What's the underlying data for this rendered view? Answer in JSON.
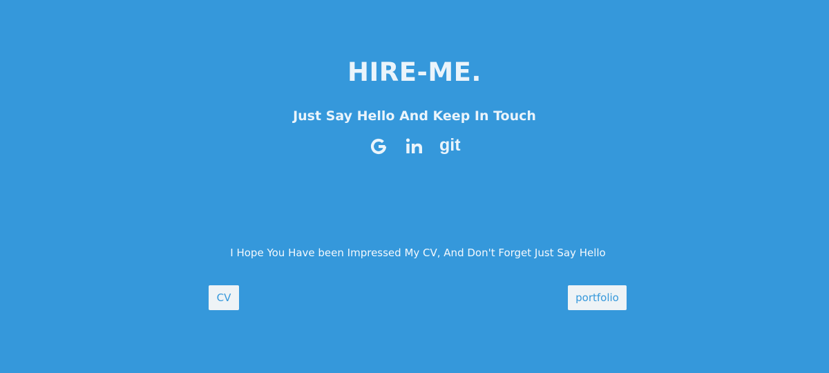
{
  "theme": {
    "background": "#3598db",
    "button_background": "#eef3f6",
    "button_text": "#3598db"
  },
  "header": {
    "title": "HIRE-ME.",
    "subtitle": "Just Say Hello And Keep In Touch"
  },
  "socials": [
    {
      "icon": "google-icon"
    },
    {
      "icon": "linkedin-icon"
    },
    {
      "icon": "git-icon",
      "text": "git"
    }
  ],
  "main": {
    "message": "I Hope You Have been Impressed My CV, And Don't Forget Just Say Hello"
  },
  "buttons": {
    "cv_label": "CV",
    "portfolio_label": "portfolio"
  }
}
